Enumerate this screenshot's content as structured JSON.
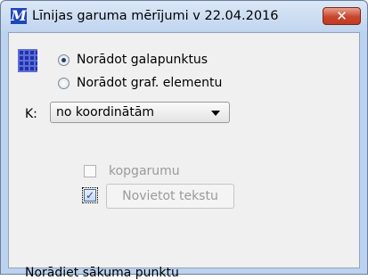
{
  "window": {
    "title": "Līnijas garuma mērījumi  v 22.04.2016",
    "app_icon_glyph": "M",
    "close_glyph": "✕"
  },
  "mode": {
    "options": [
      {
        "label": "Norādot galapunktus",
        "selected": true
      },
      {
        "label": "Norādot graf. elementu",
        "selected": false
      }
    ]
  },
  "k": {
    "label": "K:",
    "selected": "no koordinātām"
  },
  "options": {
    "kopgarumu_label": "kopgarumu",
    "kopgarumu_checked": false,
    "place_text_checked": true,
    "place_text_button": "Novietot tekstu",
    "check_glyph": "✓"
  },
  "status": "Norādiet sākuma punktu"
}
